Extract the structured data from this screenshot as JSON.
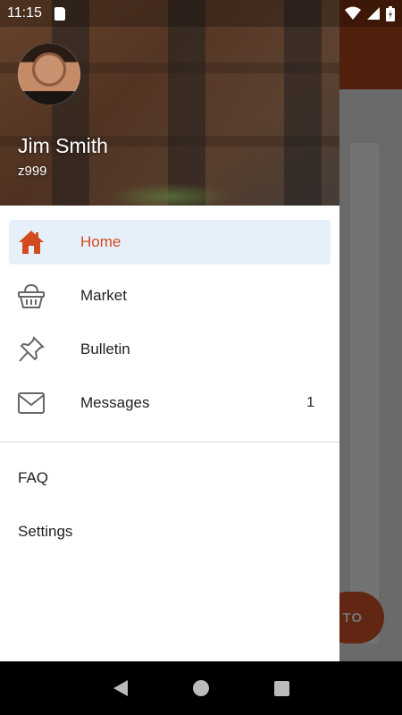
{
  "status_bar": {
    "time": "11:15"
  },
  "background": {
    "fab_label": "TO"
  },
  "drawer": {
    "user": {
      "name": "Jim Smith",
      "id": "z999"
    },
    "nav_items": [
      {
        "label": "Home",
        "icon": "home-icon",
        "active": true
      },
      {
        "label": "Market",
        "icon": "basket-icon"
      },
      {
        "label": "Bulletin",
        "icon": "pushpin-icon"
      },
      {
        "label": "Messages",
        "icon": "mail-icon",
        "count": "1"
      }
    ],
    "secondary_items": [
      {
        "label": "FAQ"
      },
      {
        "label": "Settings"
      }
    ]
  },
  "colors": {
    "accent": "#d24a1f",
    "active_bg": "#e6f0fa",
    "appbar": "#b64a1d"
  }
}
